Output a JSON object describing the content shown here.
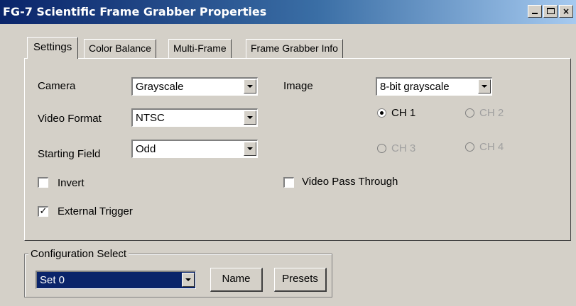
{
  "window": {
    "title": "FG-7 Scientific Frame Grabber Properties",
    "controls": {
      "minimize": "_",
      "maximize": "□",
      "close": "×"
    }
  },
  "tabs": [
    {
      "label": "Settings",
      "active": true
    },
    {
      "label": "Color Balance",
      "active": false
    },
    {
      "label": "Multi-Frame",
      "active": false
    },
    {
      "label": "Frame Grabber Info",
      "active": false
    }
  ],
  "settings": {
    "camera": {
      "label": "Camera",
      "value": "Grayscale"
    },
    "video_format": {
      "label": "Video Format",
      "value": "NTSC"
    },
    "starting_field": {
      "label": "Starting Field",
      "value": "Odd"
    },
    "image": {
      "label": "Image",
      "value": "8-bit grayscale"
    },
    "channels": [
      {
        "label": "CH 1",
        "selected": true,
        "enabled": true
      },
      {
        "label": "CH 2",
        "selected": false,
        "enabled": false
      },
      {
        "label": "CH 3",
        "selected": false,
        "enabled": false
      },
      {
        "label": "CH 4",
        "selected": false,
        "enabled": false
      }
    ],
    "invert": {
      "label": "Invert",
      "checked": false
    },
    "external_trigger": {
      "label": "External Trigger",
      "checked": true
    },
    "video_pass_through": {
      "label": "Video Pass Through",
      "checked": false
    }
  },
  "configuration": {
    "legend": "Configuration Select",
    "value": "Set 0",
    "name_button": "Name",
    "presets_button": "Presets"
  },
  "colors": {
    "title_gradient_start": "#0a246a",
    "title_gradient_end": "#a6caf0",
    "face": "#d4d0c8",
    "selection": "#0a246a"
  }
}
